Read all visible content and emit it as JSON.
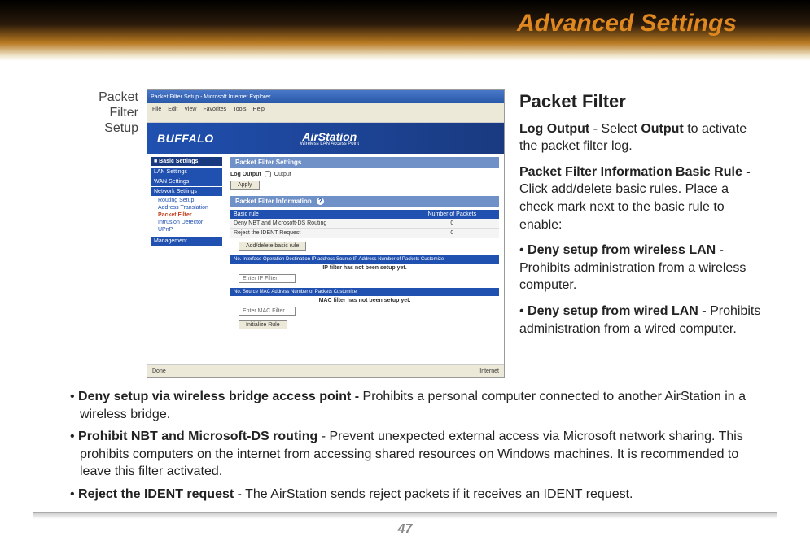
{
  "header": {
    "title": "Advanced Settings"
  },
  "side_label": {
    "line1": "Packet",
    "line2": "Filter",
    "line3": "Setup"
  },
  "screenshot": {
    "titlebar": "Packet Filter Setup - Microsoft Internet Explorer",
    "menu": [
      "File",
      "Edit",
      "View",
      "Favorites",
      "Tools",
      "Help"
    ],
    "logo_left": "BUFFALO",
    "logo_right": "AirStation",
    "logo_right_sub": "Wireless LAN Access Point",
    "sidebar": {
      "header": "■ Basic Settings",
      "items": [
        "LAN Settings",
        "WAN Settings",
        "Network Settings"
      ],
      "subs": [
        "Routing Setup",
        "Address Translation",
        "Packet Filter",
        "Intrusion Detector",
        "UPnP"
      ],
      "footer": "Management"
    },
    "main": {
      "section1": "Packet Filter Settings",
      "log_label": "Log Output",
      "log_checkbox": "Output",
      "apply_btn": "Apply",
      "section2": "Packet Filter Information",
      "help_icon": "?",
      "table1_h1": "Basic rule",
      "table1_h2": "Number of Packets",
      "table1_r1": "Deny NBT and Microsoft-DS Routing",
      "table1_r1v": "0",
      "table1_r2": "Reject the IDENT Request",
      "table1_r2v": "0",
      "add_btn": "Add/delete basic rule",
      "table2_header": "No.  Interface  Operation  Destination IP address  Source IP Address  Number of Packets  Customize",
      "note1": "IP filter has not been setup yet.",
      "input1": "Enter IP Filter",
      "table3_header": "No.        Source MAC Address                Number of Packets         Customize",
      "note2": "MAC filter has not been setup yet.",
      "input2": "Enter MAC Filter",
      "init_btn": "Initialize Rule"
    },
    "statusbar_left": "Done",
    "statusbar_right": "Internet"
  },
  "right": {
    "heading": "Packet Filter",
    "p1a": "Log Output",
    "p1b": " - Select ",
    "p1c": "Output",
    "p1d": " to activate the packet filter log.",
    "p2a": "Packet Filter Information Basic Rule - ",
    "p2b": "Click add/delete basic rules. Place a check mark next to the basic rule to enable:",
    "p3a": "Deny setup from wireless LAN",
    "p3b": " - Prohibits administration from a wireless computer.",
    "p4a": "Deny setup from wired LAN - ",
    "p4b": "Prohibits administration from a wired computer."
  },
  "bottom": {
    "i1a": "Deny setup via wireless bridge access point - ",
    "i1b": "Prohibits a personal computer connected to another AirStation in a wireless bridge.",
    "i2a": "Prohibit NBT and Microsoft-DS routing",
    "i2b": " - Prevent unexpected external access via Microsoft network sharing.  This prohibits computers on the internet from accessing shared resources on Windows machines.  It is recommended to leave this filter activated.",
    "i3a": "Reject the IDENT request",
    "i3b": " - The AirStation sends reject packets if it receives an IDENT request."
  },
  "page_number": "47"
}
